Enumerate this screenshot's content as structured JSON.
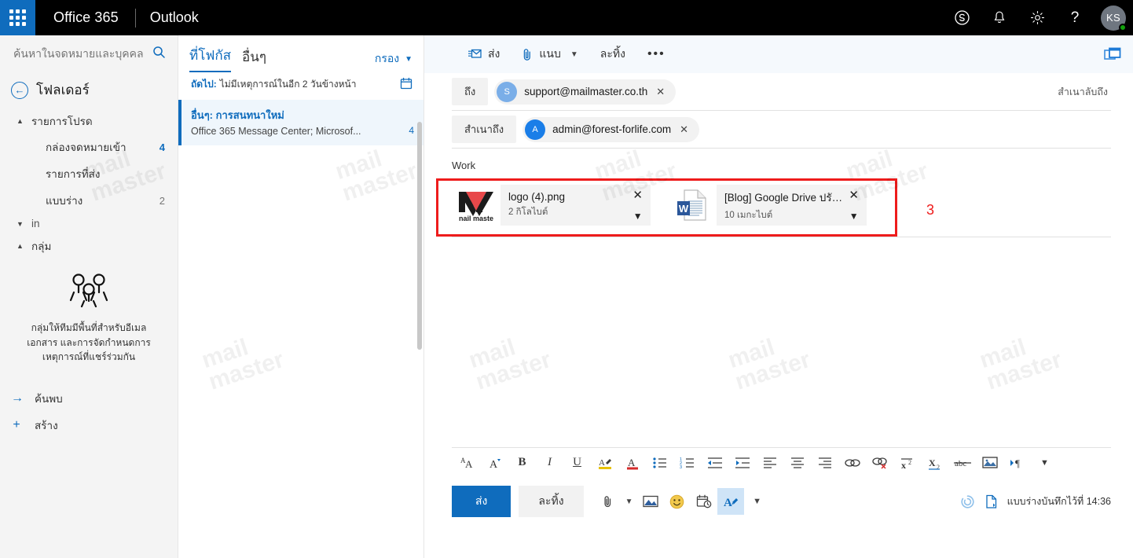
{
  "suite": {
    "waffle_icon": "app-launcher-icon",
    "brand": "Office 365",
    "app": "Outlook",
    "icons": [
      {
        "name": "skype-icon",
        "glyph": "S"
      },
      {
        "name": "notifications-bell-icon",
        "glyph": "bell"
      },
      {
        "name": "settings-gear-icon",
        "glyph": "gear"
      },
      {
        "name": "help-question-icon",
        "glyph": "?"
      }
    ],
    "avatar_initials": "KS",
    "presence": "available"
  },
  "colors": {
    "accent": "#0f6cbd",
    "suitebar_bg": "#000000",
    "annotation_red": "#ee1c1c",
    "selected_row_bg": "#eff6fc",
    "presence_green": "#13a10e"
  },
  "search": {
    "placeholder": "ค้นหาในจดหมายและบุคคล",
    "icon": "search-icon"
  },
  "sidebar": {
    "title": "โฟลเดอร์",
    "back_icon": "back-arrow-icon",
    "groups": [
      {
        "label": "รายการโปรด",
        "expanded": true,
        "items": [
          {
            "label": "กล่องจดหมายเข้า",
            "count": "4",
            "unread": true
          },
          {
            "label": "รายการที่ส่ง",
            "count": "",
            "unread": false
          },
          {
            "label": "แบบร่าง",
            "count": "2",
            "unread": false
          }
        ]
      },
      {
        "label": "in",
        "expanded": false,
        "items": []
      },
      {
        "label": "กลุ่ม",
        "expanded": true,
        "items": []
      }
    ],
    "groups_empty": {
      "icon": "people-group-icon",
      "text": "กลุ่มให้ทีมมีพื้นที่สำหรับอีเมล เอกสาร และการจัดกำหนดการเหตุการณ์ที่แชร์ร่วมกัน"
    },
    "actions": [
      {
        "label": "ค้นพบ",
        "icon": "arrow-right-icon"
      },
      {
        "label": "สร้าง",
        "icon": "plus-icon"
      }
    ]
  },
  "message_list": {
    "pivots": [
      {
        "label": "ที่โฟกัส",
        "selected": true
      },
      {
        "label": "อื่นๆ",
        "selected": false
      }
    ],
    "filter": {
      "label": "กรอง",
      "icon": "chevron-down-icon"
    },
    "next_bar": {
      "key": "ถัดไป:",
      "value": "ไม่มีเหตุการณ์ในอีก 2 วันข้างหน้า",
      "icon": "calendar-icon"
    },
    "rows": [
      {
        "subject": "อื่นๆ: การสนทนาใหม่",
        "preview": "Office 365 Message Center; Microsof...",
        "count": "4",
        "selected": true
      }
    ]
  },
  "compose": {
    "toolbar": [
      {
        "label": "ส่ง",
        "icon": "send-mail-icon",
        "caret": false
      },
      {
        "label": "แนบ",
        "icon": "paperclip-icon",
        "caret": true
      },
      {
        "label": "ละทิ้ง",
        "icon": "",
        "caret": false
      },
      {
        "label": "•••",
        "icon": "more-ellipsis-icon",
        "caret": false
      }
    ],
    "reading_pane_icon": "reading-pane-icon",
    "to": {
      "label": "ถึง",
      "recipients": [
        {
          "initial": "S",
          "address": "support@mailmaster.co.th",
          "avatar_color": "#7aaee8"
        }
      ]
    },
    "cc": {
      "label": "สำเนาถึง",
      "recipients": [
        {
          "initial": "A",
          "address": "admin@forest-forlife.com",
          "avatar_color": "#1a7ee8"
        }
      ]
    },
    "bcc_label": "สำเนาลับถึง",
    "subject": "Work",
    "attachments": [
      {
        "name": "logo (4).png",
        "size": "2 กิโลไบต์",
        "thumb": "nail-master-logo-thumbnail",
        "thumb_caption": "nail maste",
        "remove_icon": "close-icon",
        "menu_icon": "chevron-down-icon"
      },
      {
        "name": "[Blog] Google Drive ปรับ...",
        "size": "10 เมกะไบต์",
        "thumb": "word-document-icon",
        "thumb_caption": "W",
        "remove_icon": "close-icon",
        "menu_icon": "chevron-down-icon"
      }
    ],
    "annotation": {
      "number": "3",
      "color": "#ee1c1c"
    },
    "body": "",
    "format_toolbar": [
      {
        "name": "font-size-icon",
        "glyph": "AA"
      },
      {
        "name": "font-color-size-icon",
        "glyph": "A"
      },
      {
        "name": "bold-icon",
        "glyph": "B"
      },
      {
        "name": "italic-icon",
        "glyph": "I"
      },
      {
        "name": "underline-icon",
        "glyph": "U"
      },
      {
        "name": "highlight-icon",
        "glyph": "A"
      },
      {
        "name": "font-color-icon",
        "glyph": "A"
      },
      {
        "name": "bulleted-list-icon",
        "glyph": "list"
      },
      {
        "name": "numbered-list-icon",
        "glyph": "list"
      },
      {
        "name": "decrease-indent-icon",
        "glyph": "indent"
      },
      {
        "name": "increase-indent-icon",
        "glyph": "indent"
      },
      {
        "name": "align-left-icon",
        "glyph": "align"
      },
      {
        "name": "align-center-icon",
        "glyph": "align"
      },
      {
        "name": "align-right-icon",
        "glyph": "align"
      },
      {
        "name": "insert-link-icon",
        "glyph": "link"
      },
      {
        "name": "remove-link-icon",
        "glyph": "unlink"
      },
      {
        "name": "superscript-icon",
        "glyph": "x2"
      },
      {
        "name": "subscript-icon",
        "glyph": "x2"
      },
      {
        "name": "strikethrough-icon",
        "glyph": "abc"
      },
      {
        "name": "insert-image-icon",
        "glyph": "image"
      },
      {
        "name": "text-direction-icon",
        "glyph": "pilcrow"
      },
      {
        "name": "more-formatting-icon",
        "glyph": "chevron"
      }
    ],
    "send_bar": {
      "send_label": "ส่ง",
      "discard_label": "ละทิ้ง",
      "icons": [
        {
          "name": "attach-file-icon",
          "caret": true
        },
        {
          "name": "insert-picture-icon",
          "caret": false
        },
        {
          "name": "emoji-icon",
          "caret": false
        },
        {
          "name": "schedule-later-icon",
          "caret": false
        },
        {
          "name": "formatting-options-icon",
          "caret": false,
          "active": true
        },
        {
          "name": "more-options-chevron-icon",
          "caret": false
        }
      ],
      "saved_status": "แบบร่างบันทึกไว้ที่ 14:36",
      "status_icons": [
        {
          "name": "sync-spinner-icon"
        },
        {
          "name": "save-draft-icon"
        }
      ]
    }
  },
  "watermark": "mail master"
}
